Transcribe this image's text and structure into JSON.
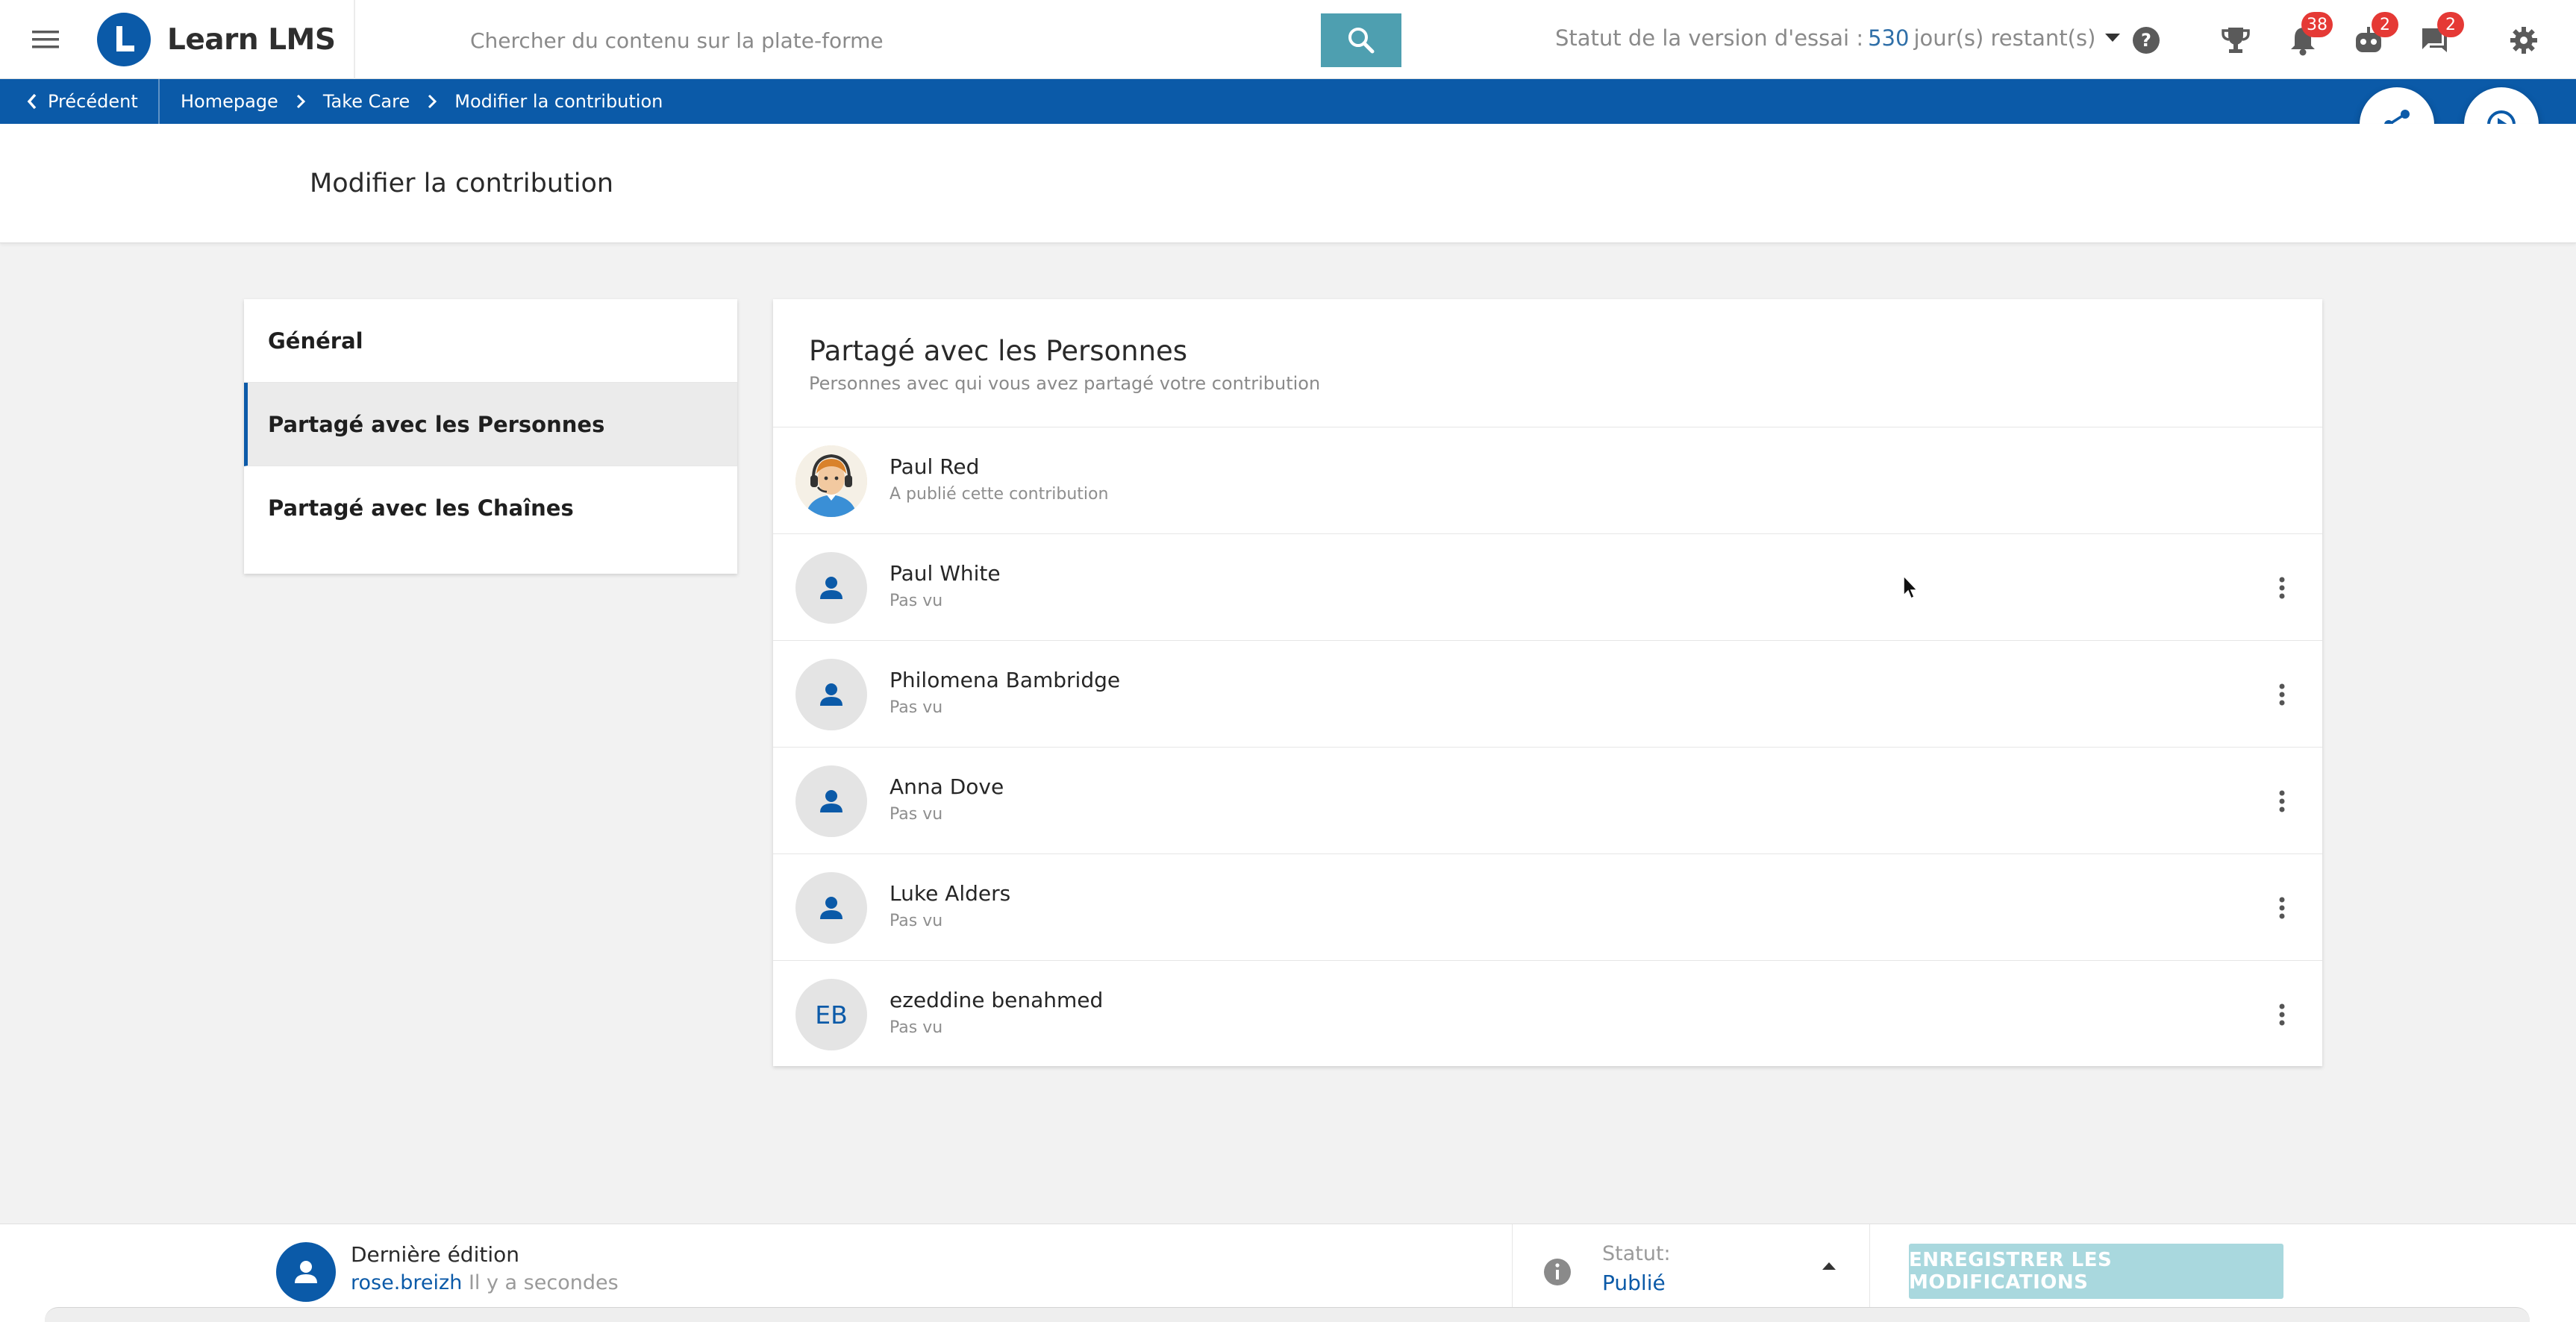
{
  "header": {
    "app_name": "Learn LMS",
    "search_placeholder": "Chercher du contenu sur la plate-forme",
    "trial_prefix": "Statut de la version d'essai :",
    "trial_days": "530",
    "trial_suffix": "jour(s) restant(s)",
    "notifications_count": "38",
    "bot_count": "2",
    "messages_count": "2",
    "icons": [
      "menu-icon",
      "search-icon",
      "help-icon",
      "trophy-icon",
      "bell-icon",
      "robot-icon",
      "chat-icon",
      "gear-icon"
    ]
  },
  "breadcrumb": {
    "back_label": "Précédent",
    "items": [
      "Homepage",
      "Take Care",
      "Modifier la contribution"
    ]
  },
  "page": {
    "title": "Modifier la contribution"
  },
  "sidenav": {
    "items": [
      {
        "label": "Général",
        "active": false
      },
      {
        "label": "Partagé avec les Personnes",
        "active": true
      },
      {
        "label": "Partagé avec les Chaînes",
        "active": false
      }
    ]
  },
  "panel": {
    "title": "Partagé avec les Personnes",
    "subtitle": "Personnes avec qui vous avez partagé votre contribution",
    "people": [
      {
        "name": "Paul Red",
        "status": "A publié cette contribution",
        "avatar": "photo"
      },
      {
        "name": "Paul White",
        "status": "Pas vu",
        "avatar": "person-icon"
      },
      {
        "name": "Philomena Bambridge",
        "status": "Pas vu",
        "avatar": "person-icon"
      },
      {
        "name": "Anna Dove",
        "status": "Pas vu",
        "avatar": "person-icon"
      },
      {
        "name": "Luke Alders",
        "status": "Pas vu",
        "avatar": "person-icon"
      },
      {
        "name": "ezeddine benahmed",
        "status": "Pas vu",
        "avatar": "initials",
        "initials": "EB"
      }
    ]
  },
  "footer": {
    "last_edit_title": "Dernière édition",
    "last_edit_user": "rose.breizh",
    "last_edit_time": "Il y a secondes",
    "status_label": "Statut:",
    "status_value": "Publié",
    "save_label": "ENREGISTRER LES MODIFICATIONS"
  },
  "colors": {
    "brand_blue": "#0b5aa8",
    "search_button": "#4e9fb0",
    "badge_red": "#e53935",
    "save_disabled": "#a9d8de"
  }
}
